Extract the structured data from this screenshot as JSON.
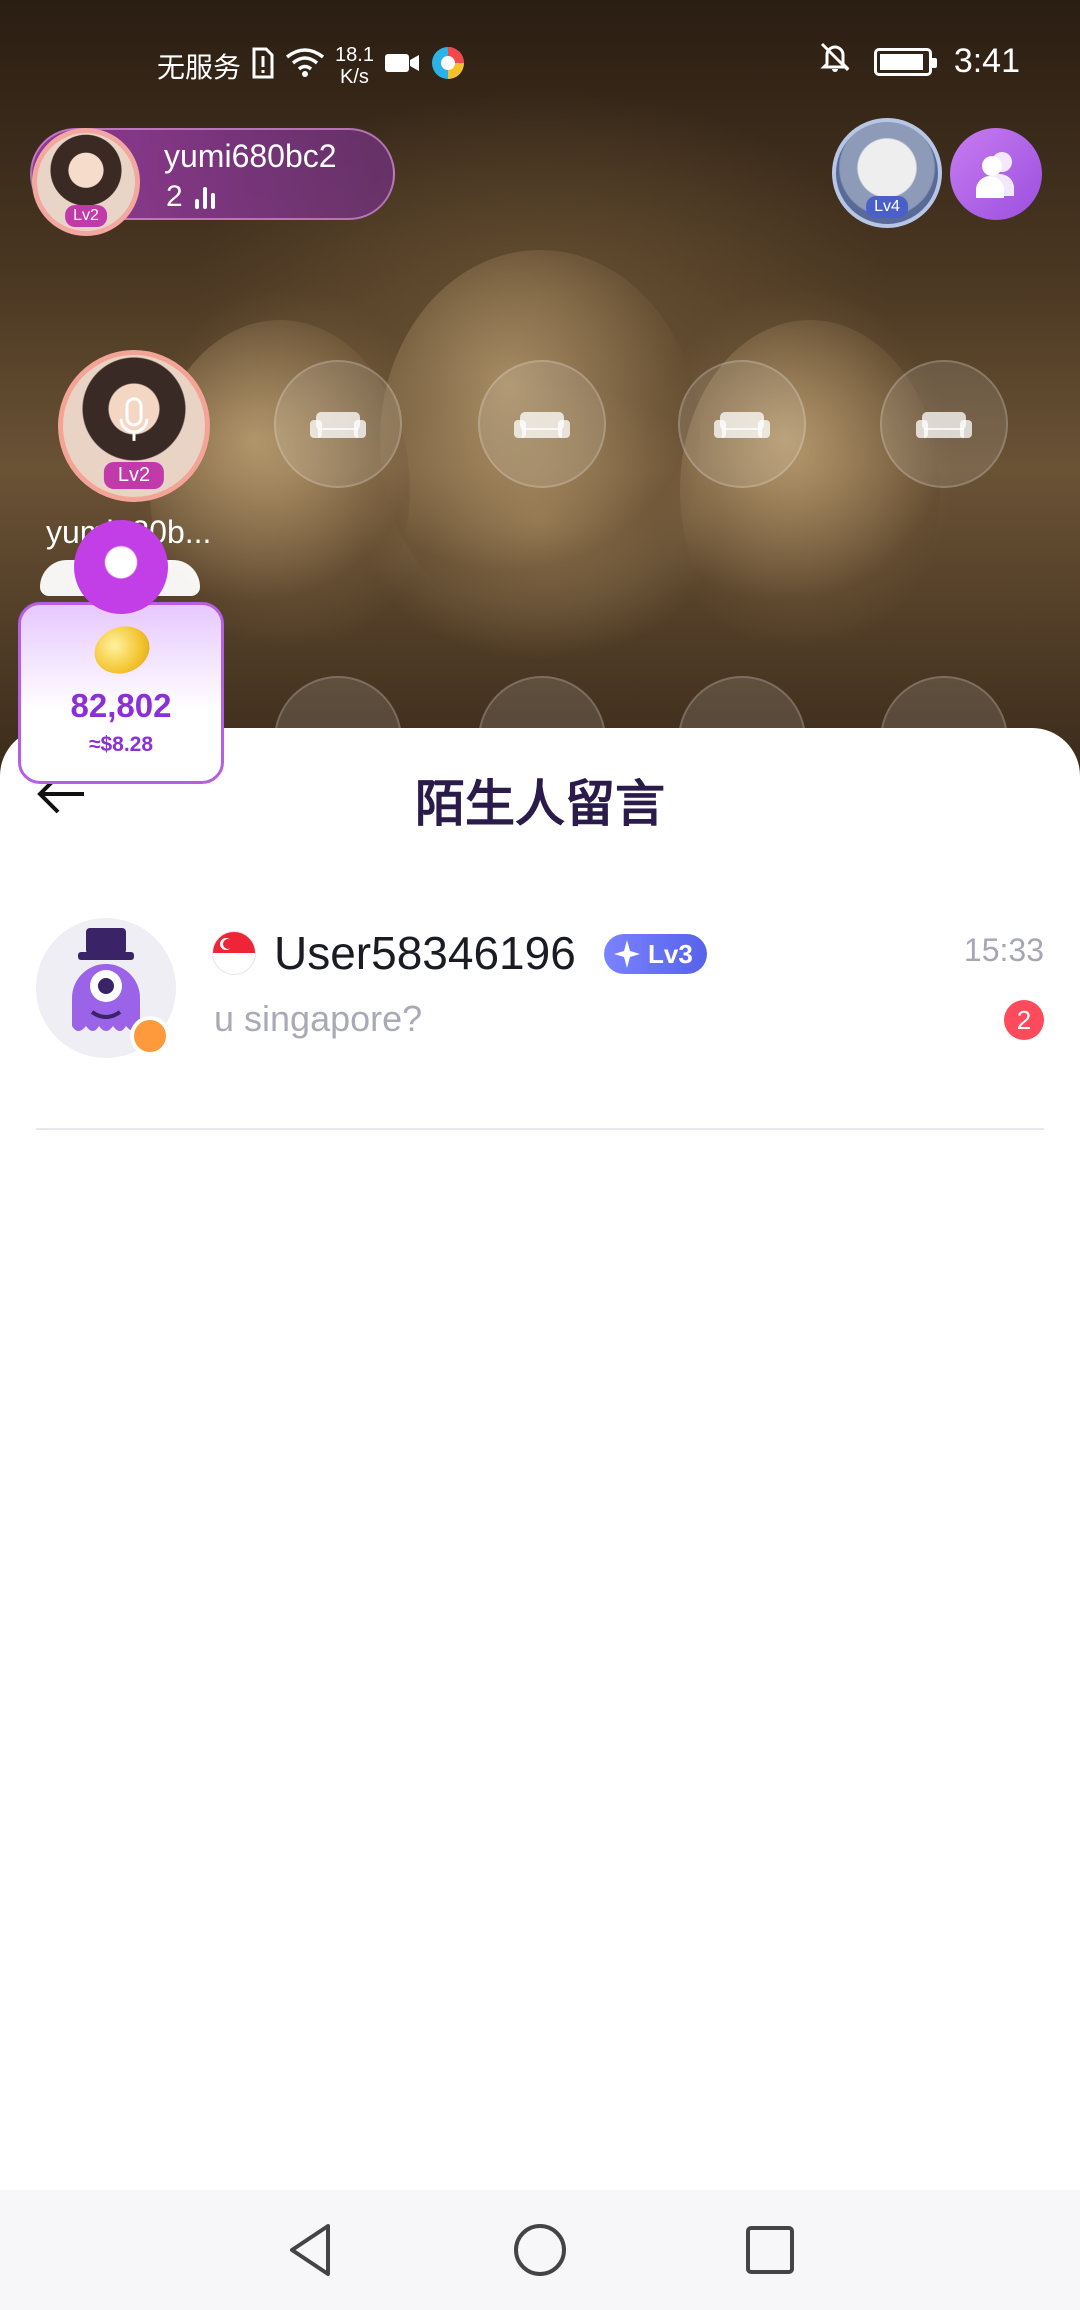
{
  "status_bar": {
    "carrier": "无服务",
    "speed_value": "18.1",
    "speed_unit": "K/s",
    "time": "3:41"
  },
  "host": {
    "name": "yumi680bc2",
    "level": "Lv2",
    "listener_count": "2"
  },
  "top_right": {
    "badge_level": "Lv4"
  },
  "seat_host": {
    "name": "yumi680b...",
    "level": "Lv2"
  },
  "coin_widget": {
    "value": "82,802",
    "usd": "≈$8.28"
  },
  "sheet": {
    "title": "陌生人留言",
    "messages": [
      {
        "name": "User58346196",
        "level": "Lv3",
        "time": "15:33",
        "preview": "u singapore?",
        "unread": "2",
        "flag": "singapore-flag"
      }
    ]
  },
  "colors": {
    "accent_purple": "#8b2fd6",
    "badge_blue": "#5663ea",
    "unread_red": "#ff4b5c",
    "online_orange": "#ff9a3c",
    "title_dark": "#2a1b4a"
  }
}
